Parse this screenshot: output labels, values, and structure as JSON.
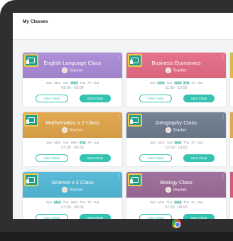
{
  "page": {
    "title": "My Classes"
  },
  "colors": {
    "accent": "#34c3b0",
    "badge": "#1f9f8b",
    "active_day_bg": "#c9efe9"
  },
  "classes": [
    {
      "name": "English Language Class",
      "teacher": "Teacher",
      "color": "#a98ad6",
      "days": [
        "Sun",
        "Mon",
        "Tue",
        "Wed",
        "Thu",
        "Fri",
        "Sat"
      ],
      "active_days": [
        "Wed"
      ],
      "time": "08:00 - 09:00",
      "view_label": "View Class",
      "start_label": "Start Class"
    },
    {
      "name": "Business Economics",
      "teacher": "Teacher",
      "color": "#e36b84",
      "days": [
        "Sun",
        "Mon",
        "Tue",
        "Wed",
        "Thu",
        "Fri",
        "Sat"
      ],
      "active_days": [
        "Mon",
        "Wed",
        "Thu"
      ],
      "time": "11:00 - 12:00",
      "view_label": "View Class",
      "start_label": "Start Class"
    },
    {
      "name": "Mathematics x 2 Class",
      "teacher": "Teacher",
      "color": "#dfa449",
      "days": [
        "Sun",
        "Mon",
        "Tue",
        "Wed",
        "Thu",
        "Fri",
        "Sat"
      ],
      "active_days": [
        "Thu"
      ],
      "time": "07:00 - 08:00",
      "view_label": "View Class",
      "start_label": "Start Class"
    },
    {
      "name": "Geography Class",
      "teacher": "Teacher",
      "color": "#6d7c8f",
      "days": [
        "Sun",
        "Mon",
        "Tue",
        "Wed",
        "Thu",
        "Fri",
        "Sat"
      ],
      "active_days": [
        "Wed"
      ],
      "time": "12:00 - 13:00",
      "view_label": "View Class",
      "start_label": "Start Class"
    },
    {
      "name": "Science x 2 Class",
      "teacher": "Teacher",
      "color": "#52b8d6",
      "days": [
        "Sun",
        "Mon",
        "Tue",
        "Wed",
        "Thu",
        "Fri",
        "Sat"
      ],
      "active_days": [
        "Mon"
      ],
      "time": "07:00 - 08:00",
      "view_label": "View Class",
      "start_label": "Start Class"
    },
    {
      "name": "Biology Class",
      "teacher": "Teacher",
      "color": "#9b6b98",
      "days": [
        "Sun",
        "Mon",
        "Tue",
        "Wed",
        "Thu",
        "Fri",
        "Sat"
      ],
      "active_days": [
        "Wed"
      ],
      "time": "07:00 - 08:00",
      "view_label": "View Class",
      "start_label": "Start Class"
    }
  ],
  "edge_colors": [
    "#d9b94f",
    "#e0a94f",
    "#cc5d7e"
  ],
  "taskbar": {
    "icon": "chrome-icon"
  }
}
